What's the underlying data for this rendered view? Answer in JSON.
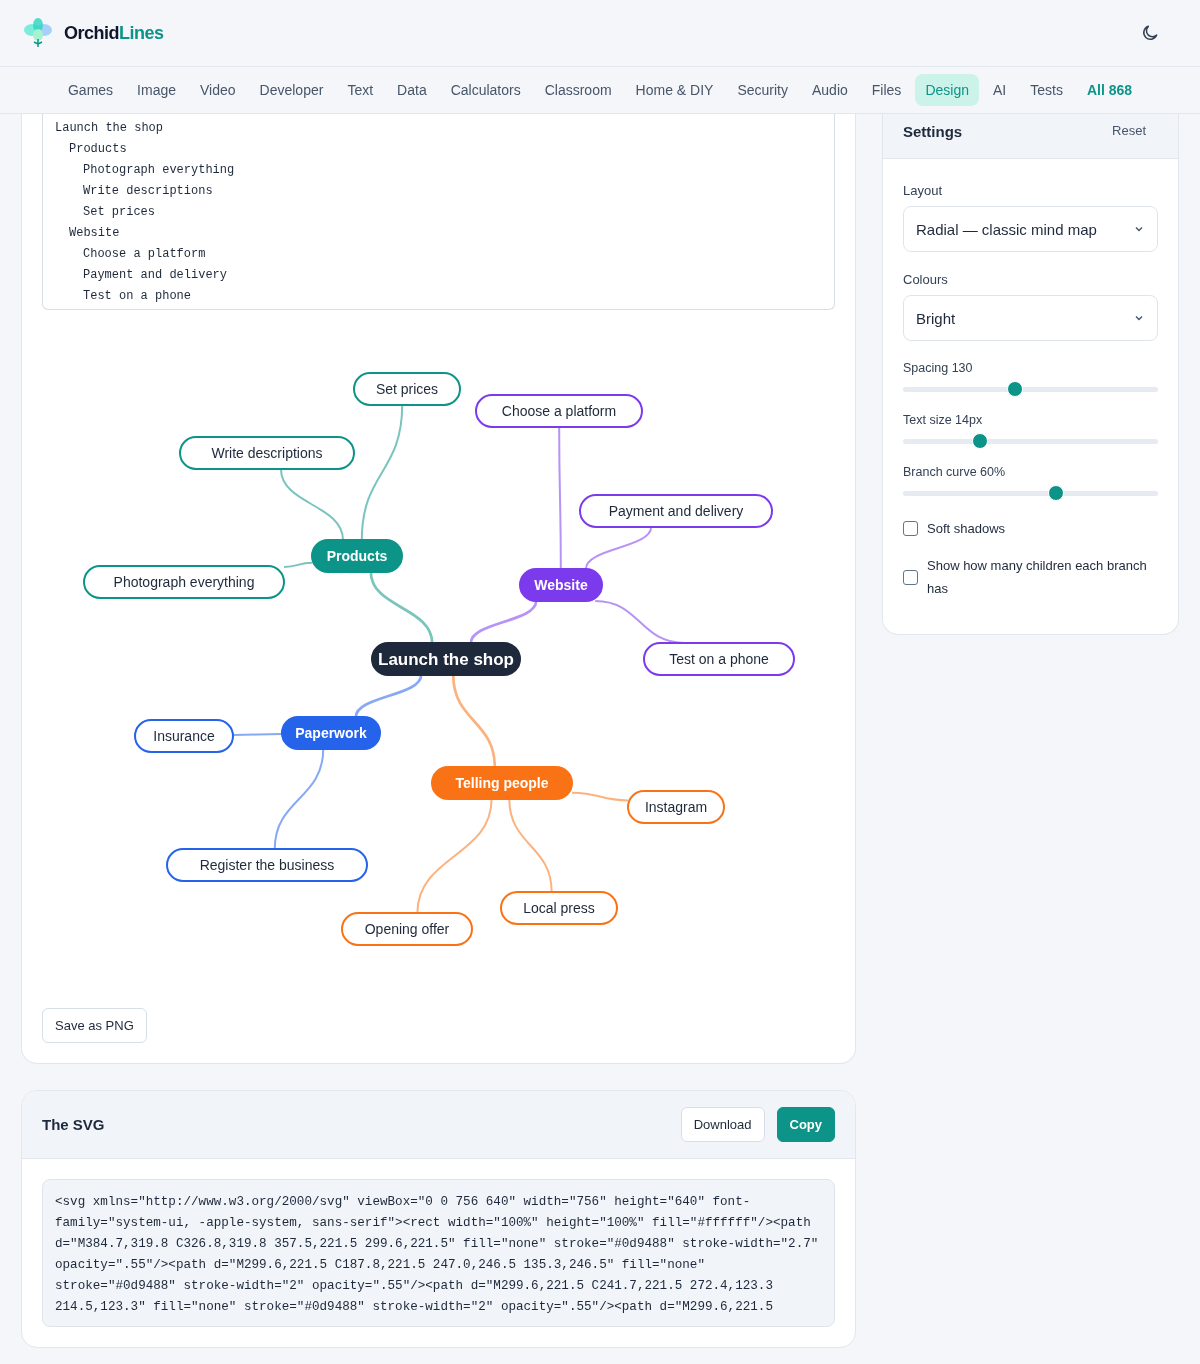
{
  "brand": {
    "name_part1": "Orchid",
    "name_part2": "Lines"
  },
  "nav": [
    {
      "label": "Games",
      "selected": false,
      "emphasized": false
    },
    {
      "label": "Image",
      "selected": false,
      "emphasized": false
    },
    {
      "label": "Video",
      "selected": false,
      "emphasized": false
    },
    {
      "label": "Developer",
      "selected": false,
      "emphasized": false
    },
    {
      "label": "Text",
      "selected": false,
      "emphasized": false
    },
    {
      "label": "Data",
      "selected": false,
      "emphasized": false
    },
    {
      "label": "Calculators",
      "selected": false,
      "emphasized": false
    },
    {
      "label": "Classroom",
      "selected": false,
      "emphasized": false
    },
    {
      "label": "Home & DIY",
      "selected": false,
      "emphasized": false
    },
    {
      "label": "Security",
      "selected": false,
      "emphasized": false
    },
    {
      "label": "Audio",
      "selected": false,
      "emphasized": false
    },
    {
      "label": "Files",
      "selected": false,
      "emphasized": false
    },
    {
      "label": "Design",
      "selected": true,
      "emphasized": false
    },
    {
      "label": "AI",
      "selected": false,
      "emphasized": false
    },
    {
      "label": "Tests",
      "selected": false,
      "emphasized": false
    },
    {
      "label": "All 868",
      "selected": false,
      "emphasized": true
    }
  ],
  "outline": [
    {
      "text": "Launch the shop",
      "children": [
        {
          "text": "Products",
          "children": [
            {
              "text": "Photograph everything"
            },
            {
              "text": "Write descriptions"
            },
            {
              "text": "Set prices"
            }
          ]
        },
        {
          "text": "Website",
          "children": [
            {
              "text": "Choose a platform"
            },
            {
              "text": "Payment and delivery"
            },
            {
              "text": "Test on a phone"
            }
          ]
        }
      ]
    }
  ],
  "mind_map": {
    "root": "Launch the shop",
    "branches": [
      {
        "label": "Products",
        "color": "#0d9488",
        "children": [
          "Photograph everything",
          "Write descriptions",
          "Set prices"
        ]
      },
      {
        "label": "Website",
        "color": "#7c3aed",
        "children": [
          "Choose a platform",
          "Payment and delivery",
          "Test on a phone"
        ]
      },
      {
        "label": "Telling people",
        "color": "#f97316",
        "children": [
          "Instagram",
          "Local press",
          "Opening offer"
        ]
      },
      {
        "label": "Paperwork",
        "color": "#2563eb",
        "children": [
          "Register the business",
          "Insurance"
        ]
      }
    ]
  },
  "save_button": "Save as PNG",
  "svg_panel": {
    "title": "The SVG",
    "buttons": [
      "Download",
      "Copy"
    ],
    "code": "<svg xmlns=\"http://www.w3.org/2000/svg\" viewBox=\"0 0 756 640\" width=\"756\" height=\"640\" font-family=\"system-ui, -apple-system, sans-serif\"><rect width=\"100%\" height=\"100%\" fill=\"#ffffff\"/><path d=\"M384.7,319.8 C326.8,319.8 357.5,221.5 299.6,221.5\" fill=\"none\" stroke=\"#0d9488\" stroke-width=\"2.7\" opacity=\".55\"/><path d=\"M299.6,221.5 C187.8,221.5 247.0,246.5 135.3,246.5\" fill=\"none\" stroke=\"#0d9488\" stroke-width=\"2\" opacity=\".55\"/><path d=\"M299.6,221.5 C241.7,221.5 272.4,123.3 214.5,123.3\" fill=\"none\" stroke=\"#0d9488\" stroke-width=\"2\" opacity=\".55\"/><path d=\"M299.6,221.5"
  },
  "settings": {
    "title": "Settings",
    "reset": "Reset",
    "selects": [
      {
        "label": "Layout",
        "value": "Radial — classic mind map"
      },
      {
        "label": "Colours",
        "value": "Bright"
      }
    ],
    "sliders": [
      {
        "label": "Spacing 130",
        "level": 0.44
      },
      {
        "label": "Text size 14px",
        "level": 0.3
      },
      {
        "label": "Branch curve 60%",
        "level": 0.6
      }
    ],
    "checkboxes": [
      {
        "label": "Soft shadows",
        "checked": false
      },
      {
        "label": "Show how many children each branch has",
        "checked": false
      }
    ]
  }
}
